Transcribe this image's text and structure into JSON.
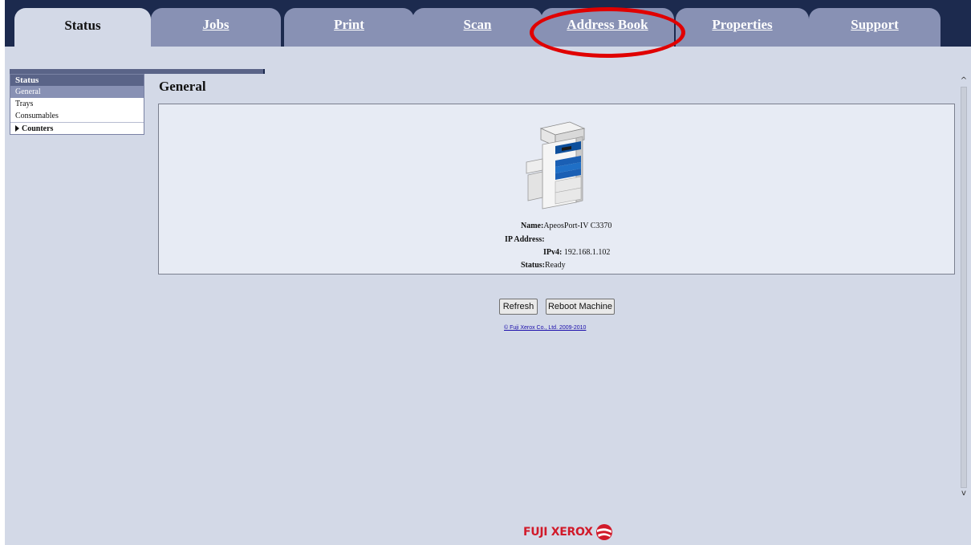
{
  "tabs": [
    {
      "label": "Status",
      "active": true
    },
    {
      "label": "Jobs"
    },
    {
      "label": "Print"
    },
    {
      "label": "Scan"
    },
    {
      "label": "Address Book"
    },
    {
      "label": "Properties"
    },
    {
      "label": "Support"
    }
  ],
  "sidebar": {
    "header": "Status",
    "items": [
      {
        "label": "General",
        "selected": true
      },
      {
        "label": "Trays"
      },
      {
        "label": "Consumables"
      },
      {
        "label": "Counters"
      }
    ]
  },
  "main": {
    "title": "General",
    "info": {
      "name_label": "Name:",
      "name_value": "ApeosPort-IV C3370",
      "ip_label": "IP Address:",
      "ipv4_label": "IPv4:",
      "ipv4_value": " 192.168.1.102",
      "status_label": "Status:",
      "status_value": "Ready"
    },
    "buttons": {
      "refresh": "Refresh",
      "reboot": "Reboot Machine"
    },
    "copyright": "© Fuji Xerox Co., Ltd. 2009-2010"
  },
  "footer": {
    "logo_text": "FUJI XEROX"
  },
  "colors": {
    "tab_bar": "#1c2a4e",
    "tab": "#8891b4",
    "background": "#d3d9e7",
    "annotation": "#e00000",
    "logo": "#d11a2a"
  }
}
